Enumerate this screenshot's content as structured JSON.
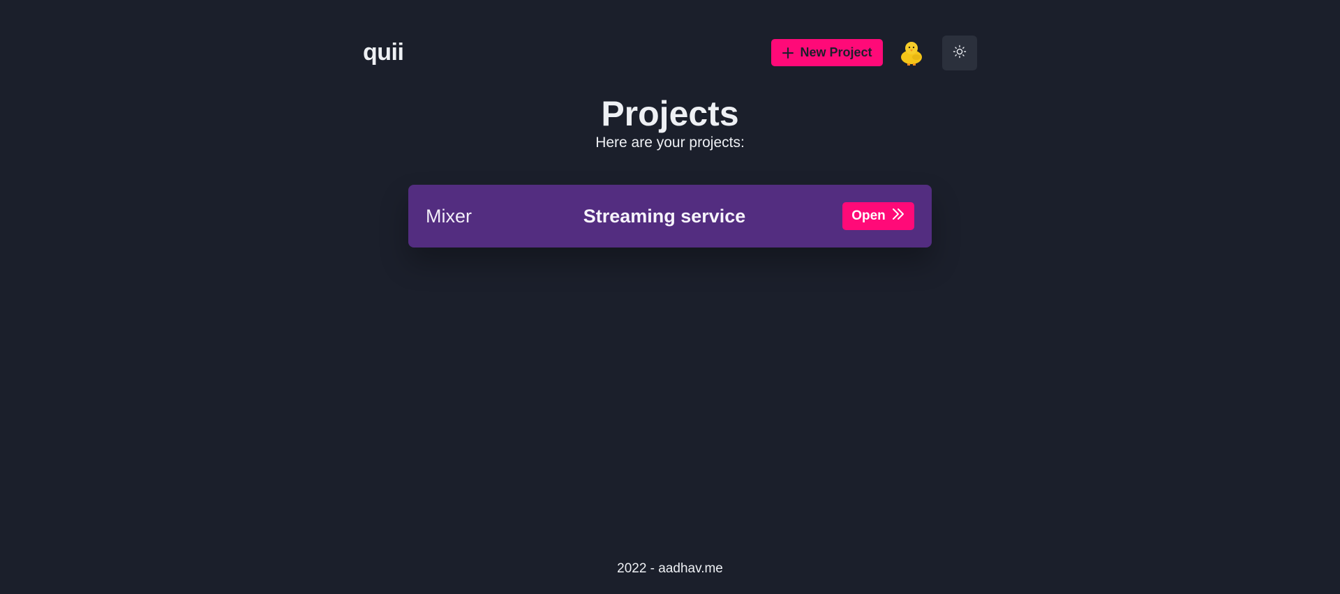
{
  "header": {
    "brand": "quii",
    "new_project_label": "New Project",
    "plus_icon": "plus-icon",
    "avatar_icon": "chick-avatar-icon",
    "theme_icon": "sun-icon"
  },
  "main": {
    "title": "Projects",
    "subtitle": "Here are your projects:",
    "projects": [
      {
        "name": "Mixer",
        "description": "Streaming service",
        "open_label": "Open",
        "open_icon": "double-chevron-right-icon"
      }
    ]
  },
  "footer": {
    "text": "2022 - aadhav.me"
  },
  "colors": {
    "background": "#1b1f2b",
    "accent": "#ff0a78",
    "card": "#532d80",
    "theme_button": "#2b303c"
  }
}
